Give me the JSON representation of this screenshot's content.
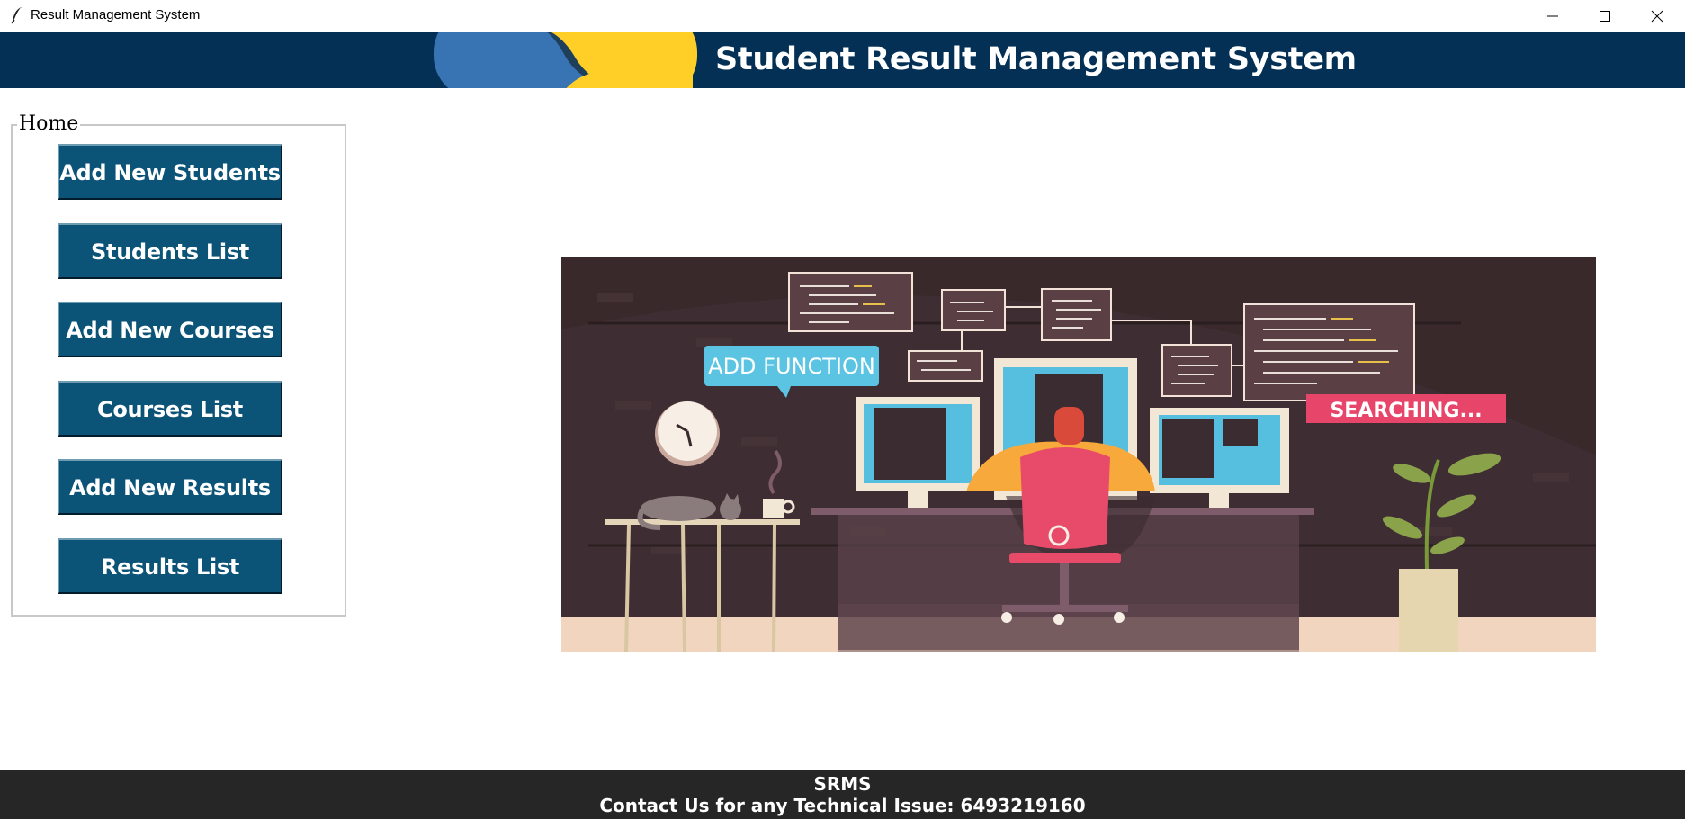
{
  "window": {
    "title": "Result Management System",
    "controls": [
      "minimize",
      "maximize",
      "close"
    ]
  },
  "header": {
    "title": "Student Result Management System",
    "background_color": "#033054"
  },
  "home": {
    "legend": "Home",
    "buttons": [
      {
        "label": "Add New Students"
      },
      {
        "label": "Students List"
      },
      {
        "label": "Add New Courses"
      },
      {
        "label": "Courses List"
      },
      {
        "label": "Add New Results"
      },
      {
        "label": "Results List"
      }
    ],
    "button_color": "#0b5377"
  },
  "illustration": {
    "bubble_text": "ADD FUNCTION",
    "banner_text": "SEARCHING..."
  },
  "footer": {
    "line1": "SRMS",
    "line2": "Contact Us for any Technical Issue: 6493219160",
    "background_color": "#262626"
  }
}
